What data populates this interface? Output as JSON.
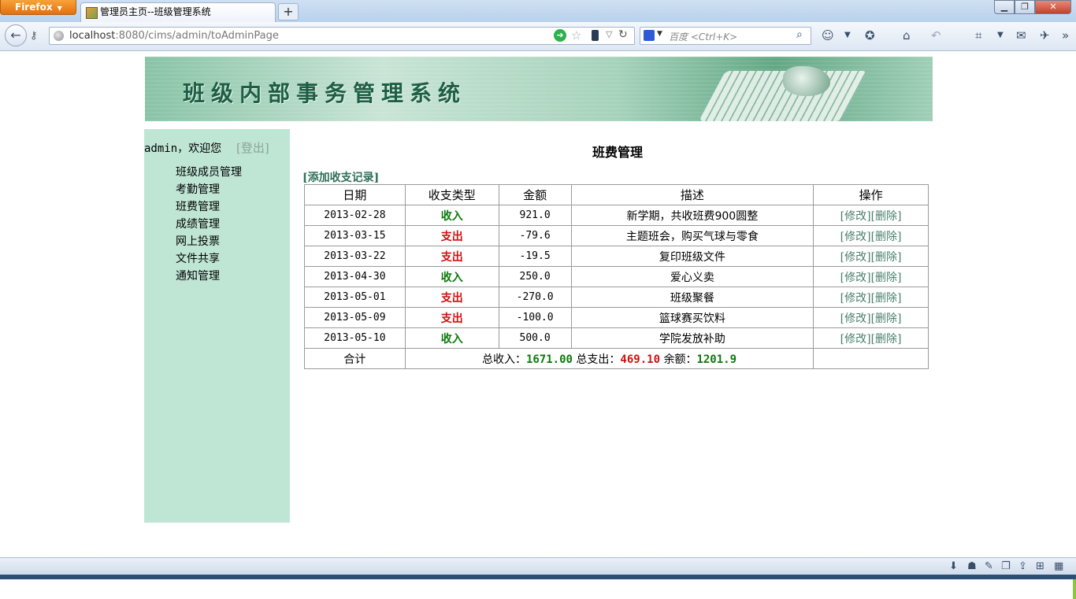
{
  "browser": {
    "app_button": "Firefox",
    "tab_title": "管理员主页--班级管理系统",
    "new_tab": "+",
    "url_host": "localhost",
    "url_path": ":8080/cims/admin/toAdminPage",
    "search_placeholder": "百度 <Ctrl+K>",
    "icons": [
      "back-arrow-icon",
      "key-icon",
      "globe-icon",
      "go-icon",
      "star-icon",
      "phone-icon",
      "reload-icon",
      "search-engine-icon",
      "search-icon",
      "smiley-icon",
      "bookmark-icon",
      "home-icon",
      "undo-icon",
      "crop-icon",
      "chat-icon",
      "extension-icon",
      "download-icon",
      "mask-icon",
      "brush-icon",
      "window-icon",
      "share-icon",
      "add-icon",
      "grid-icon"
    ]
  },
  "banner": {
    "title": "班级内部事务管理系统"
  },
  "sidebar": {
    "welcome": "admin，欢迎您",
    "logout": "[登出]",
    "items": [
      {
        "label": "班级成员管理"
      },
      {
        "label": "考勤管理"
      },
      {
        "label": "班费管理"
      },
      {
        "label": "成绩管理"
      },
      {
        "label": "网上投票"
      },
      {
        "label": "文件共享"
      },
      {
        "label": "通知管理"
      }
    ]
  },
  "main": {
    "title": "班费管理",
    "add_link": "[添加收支记录]",
    "columns": [
      "日期",
      "收支类型",
      "金额",
      "描述",
      "操作"
    ],
    "rows": [
      {
        "date": "2013-02-28",
        "type": "收入",
        "kind": "income",
        "amount": "921.0",
        "desc": "新学期，共收班费900圆整",
        "edit": "[修改]",
        "del": "[删除]"
      },
      {
        "date": "2013-03-15",
        "type": "支出",
        "kind": "expense",
        "amount": "-79.6",
        "desc": "主题班会，购买气球与零食",
        "edit": "[修改]",
        "del": "[删除]"
      },
      {
        "date": "2013-03-22",
        "type": "支出",
        "kind": "expense",
        "amount": "-19.5",
        "desc": "复印班级文件",
        "edit": "[修改]",
        "del": "[删除]"
      },
      {
        "date": "2013-04-30",
        "type": "收入",
        "kind": "income",
        "amount": "250.0",
        "desc": "爱心义卖",
        "edit": "[修改]",
        "del": "[删除]"
      },
      {
        "date": "2013-05-01",
        "type": "支出",
        "kind": "expense",
        "amount": "-270.0",
        "desc": "班级聚餐",
        "edit": "[修改]",
        "del": "[删除]"
      },
      {
        "date": "2013-05-09",
        "type": "支出",
        "kind": "expense",
        "amount": "-100.0",
        "desc": "篮球赛买饮料",
        "edit": "[修改]",
        "del": "[删除]"
      },
      {
        "date": "2013-05-10",
        "type": "收入",
        "kind": "income",
        "amount": "500.0",
        "desc": "学院发放补助",
        "edit": "[修改]",
        "del": "[删除]"
      }
    ],
    "summary": {
      "label": "合计",
      "income_label": "总收入：",
      "income": "1671.00",
      "expense_label": "总支出：",
      "expense": "469.10",
      "balance_label": "余额：",
      "balance": "1201.9"
    }
  },
  "colors": {
    "sidebar_bg": "#bfe6d4",
    "income": "#0a7a0a",
    "expense": "#d01010",
    "link": "#4a7f6e"
  }
}
